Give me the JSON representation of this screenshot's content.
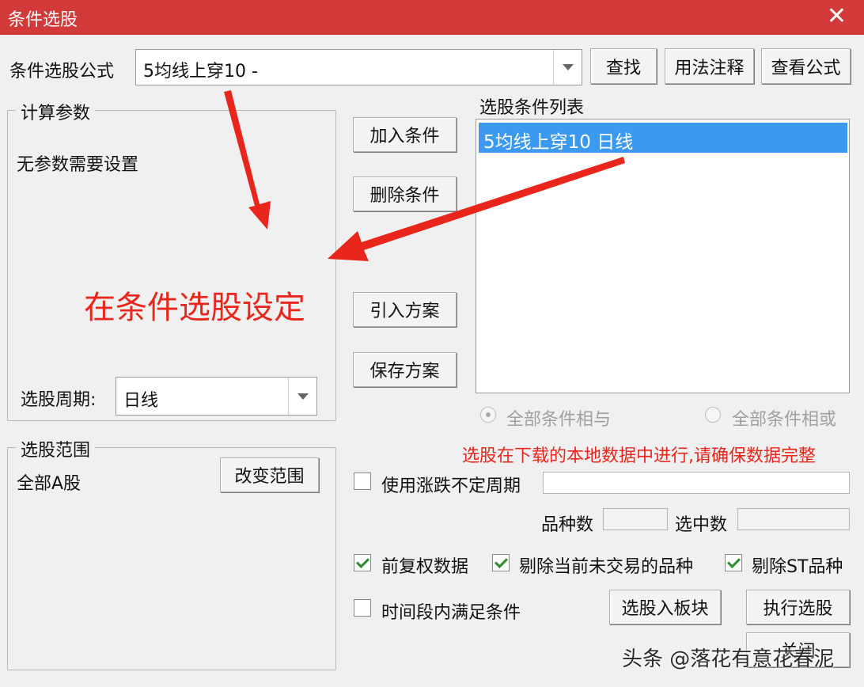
{
  "window": {
    "title": "条件选股",
    "close_glyph": "✕"
  },
  "formula": {
    "label": "条件选股公式",
    "value": "5均线上穿10   -"
  },
  "buttons": {
    "find": "查找",
    "usage_notes": "用法注释",
    "view_formula": "查看公式",
    "add_condition": "加入条件",
    "delete_condition": "删除条件",
    "import_plan": "引入方案",
    "save_plan": "保存方案",
    "change_range": "改变范围",
    "to_block": "选股入板块",
    "execute": "执行选股",
    "close": "关闭"
  },
  "params": {
    "legend": "计算参数",
    "no_params": "无参数需要设置",
    "period_label": "选股周期:",
    "period_value": "日线"
  },
  "annotation": {
    "text": "在条件选股设定",
    "arrow_color": "#e8261c"
  },
  "conditions": {
    "label": "选股条件列表",
    "items": [
      "5均线上穿10  日线"
    ],
    "radio_and": "全部条件相与",
    "radio_or": "全部条件相或"
  },
  "notice": "选股在下载的本地数据中进行,请确保数据完整",
  "range": {
    "legend": "选股范围",
    "value": "全部A股"
  },
  "options": {
    "use_uncertain_period": "使用涨跌不定周期",
    "variety_count_label": "品种数",
    "selected_count_label": "选中数",
    "forward_adjusted": "前复权数据",
    "exclude_untraded": "剔除当前未交易的品种",
    "exclude_st": "剔除ST品种",
    "time_range_condition": "时间段内满足条件"
  },
  "watermark": "头条 @落花有意花春泥",
  "colors": {
    "titlebar": "#d23a3a",
    "selection": "#3b99f0",
    "annotation": "#e8261c"
  }
}
